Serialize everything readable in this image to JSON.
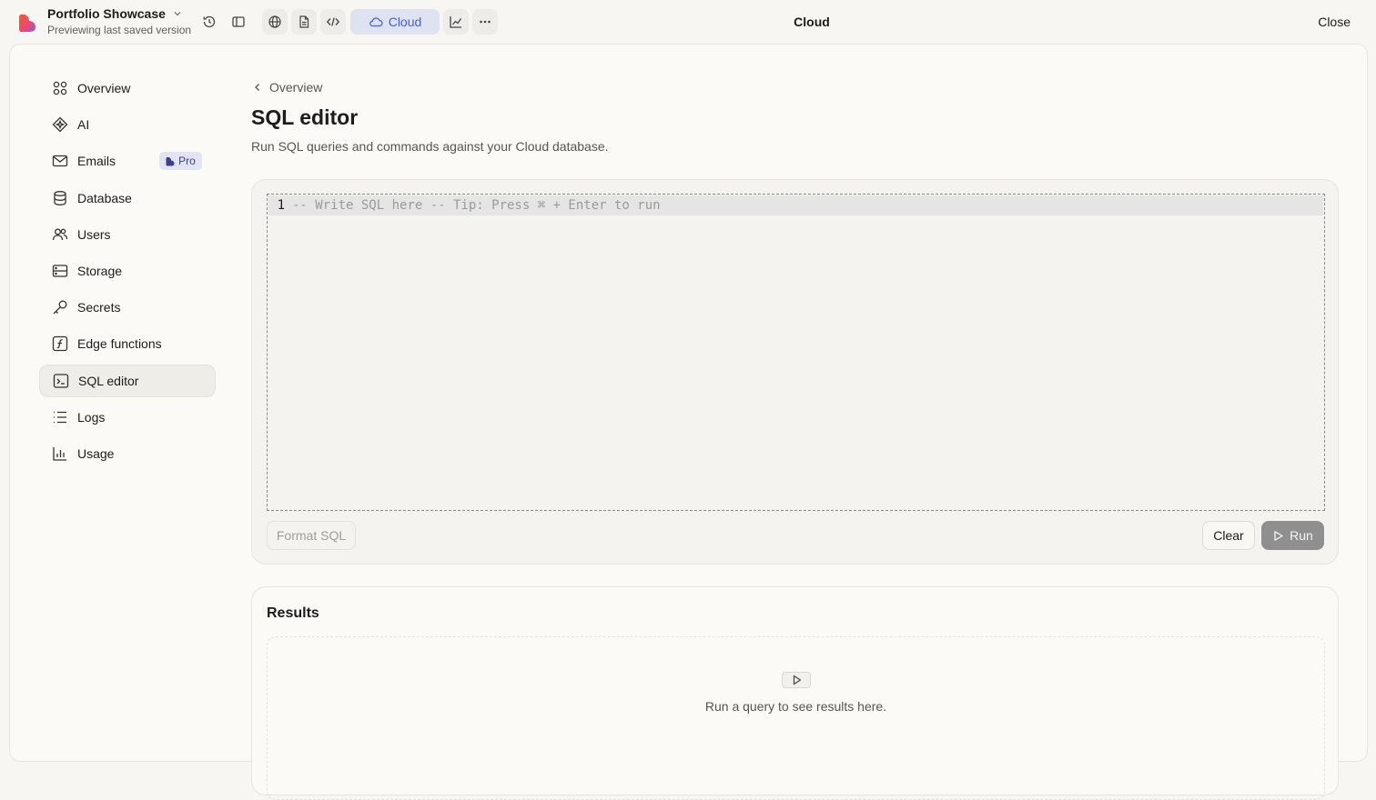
{
  "topbar": {
    "project_name": "Portfolio Showcase",
    "project_subtitle": "Previewing last saved version",
    "cloud_tab_label": "Cloud",
    "title": "Cloud",
    "close_label": "Close"
  },
  "sidebar": {
    "items": [
      {
        "label": "Overview",
        "icon": "grid-icon"
      },
      {
        "label": "AI",
        "icon": "sparkle-icon"
      },
      {
        "label": "Emails",
        "icon": "mail-icon",
        "badge": "Pro"
      },
      {
        "label": "Database",
        "icon": "database-icon"
      },
      {
        "label": "Users",
        "icon": "users-icon"
      },
      {
        "label": "Storage",
        "icon": "storage-icon"
      },
      {
        "label": "Secrets",
        "icon": "key-icon"
      },
      {
        "label": "Edge functions",
        "icon": "function-icon"
      },
      {
        "label": "SQL editor",
        "icon": "terminal-icon",
        "active": true
      },
      {
        "label": "Logs",
        "icon": "list-icon"
      },
      {
        "label": "Usage",
        "icon": "bar-chart-icon"
      }
    ]
  },
  "main": {
    "breadcrumb": "Overview",
    "title": "SQL editor",
    "description": "Run SQL queries and commands against your Cloud database.",
    "editor": {
      "line_number": "1",
      "placeholder": "-- Write SQL here -- Tip: Press ⌘ + Enter to run"
    },
    "buttons": {
      "format": "Format SQL",
      "clear": "Clear",
      "run": "Run"
    },
    "results": {
      "title": "Results",
      "empty_text": "Run a query to see results here."
    }
  },
  "colors": {
    "accent": "#4b5fd6",
    "cloud_tab_bg": "#dfe3f1",
    "run_button_bg": "#8f8f8f"
  }
}
